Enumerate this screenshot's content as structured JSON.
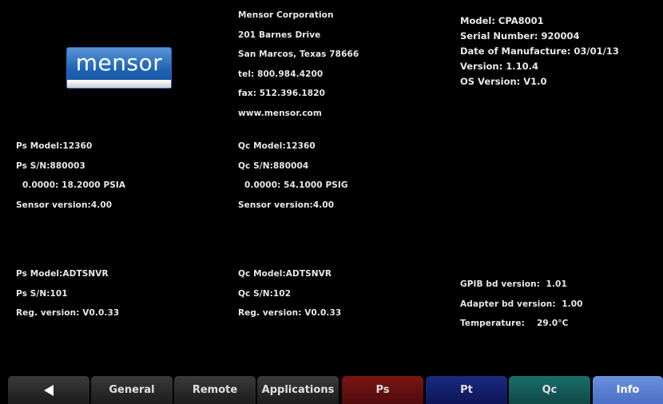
{
  "logo": {
    "text": "mensor"
  },
  "company": {
    "lines": [
      "Mensor Corporation",
      "201 Barnes Drive",
      "San Marcos, Texas 78666",
      "tel: 800.984.4200",
      "fax: 512.396.1820",
      "www.mensor.com"
    ]
  },
  "device": {
    "model": "Model: CPA8001",
    "serial": "Serial Number: 920004",
    "manufacture_date": "Date of Manufacture: 03/01/13",
    "version": "Version: 1.10.4",
    "os_version": "OS Version: V1.0"
  },
  "ps_sensor": {
    "model": "Ps Model:12360",
    "sn": "Ps S/N:880003",
    "range": "0.0000: 18.2000 PSIA",
    "version": "Sensor version:4.00"
  },
  "qc_sensor": {
    "model": "Qc Model:12360",
    "sn": "Qc S/N:880004",
    "range": "0.0000: 54.1000 PSIG",
    "version": "Sensor version:4.00"
  },
  "ps_regulator": {
    "model": "Ps Model:ADTSNVR",
    "sn": "Ps S/N:101",
    "version": "Reg. version: V0.0.33"
  },
  "qc_regulator": {
    "model": "Qc Model:ADTSNVR",
    "sn": "Qc S/N:102",
    "version": "Reg. version: V0.0.33"
  },
  "boards": {
    "gpib": "GPIB bd version:  1.01",
    "adapter": "Adapter bd version:  1.00",
    "temperature": "Temperature:    29.0°C"
  },
  "nav": {
    "back_icon": "back-arrow-icon",
    "tabs": [
      "General",
      "Remote",
      "Applications",
      "Ps",
      "Pt",
      "Qc",
      "Info"
    ],
    "active": "Info",
    "colors": {
      "gray": "#2a2a2a",
      "ps": "#6a1212",
      "pt": "#141f6e",
      "qc": "#175a58",
      "info": "#5b80d3"
    }
  }
}
